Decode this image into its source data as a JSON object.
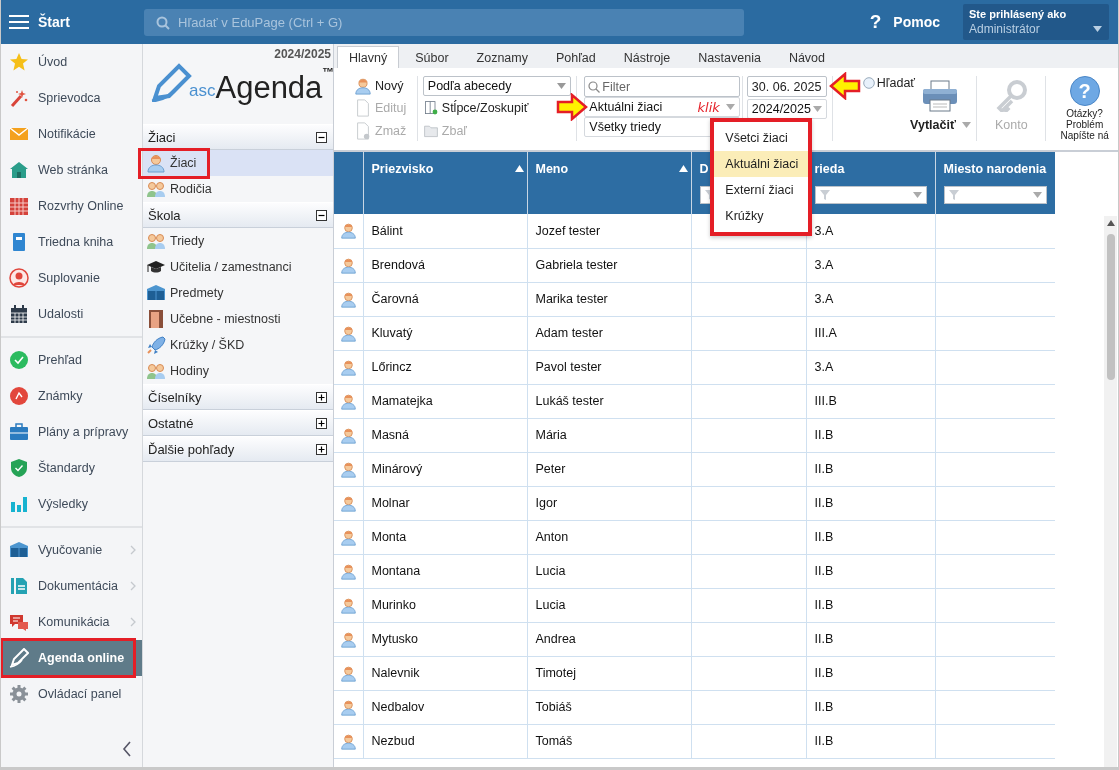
{
  "top_bar": {
    "menu_label": "Štart",
    "search": {
      "placeholder": "Hľadať v EduPage (Ctrl + G)"
    },
    "help": {
      "icon": "?",
      "label": "Pomoc"
    },
    "user": {
      "caption": "Ste prihlásený ako",
      "name": "Administrátor"
    }
  },
  "nav": {
    "sections": [
      {
        "items": [
          {
            "label": "Úvod",
            "submenu": false,
            "selected": false,
            "highlighted": false
          },
          {
            "label": "Sprievodca",
            "submenu": false,
            "selected": false,
            "highlighted": false
          },
          {
            "label": "Notifikácie",
            "submenu": false,
            "selected": false,
            "highlighted": false
          },
          {
            "label": "Web stránka",
            "submenu": false,
            "selected": false,
            "highlighted": false
          },
          {
            "label": "Rozvrhy Online",
            "submenu": false,
            "selected": false,
            "highlighted": false
          },
          {
            "label": "Triedna kniha",
            "submenu": false,
            "selected": false,
            "highlighted": false
          },
          {
            "label": "Suplovanie",
            "submenu": false,
            "selected": false,
            "highlighted": false
          },
          {
            "label": "Udalosti",
            "submenu": false,
            "selected": false,
            "highlighted": false
          }
        ]
      },
      {
        "items": [
          {
            "label": "Prehľad",
            "submenu": false,
            "selected": false,
            "highlighted": false
          },
          {
            "label": "Známky",
            "submenu": false,
            "selected": false,
            "highlighted": false
          },
          {
            "label": "Plány a prípravy",
            "submenu": false,
            "selected": false,
            "highlighted": false
          },
          {
            "label": "Štandardy",
            "submenu": false,
            "selected": false,
            "highlighted": false
          },
          {
            "label": "Výsledky",
            "submenu": false,
            "selected": false,
            "highlighted": false
          }
        ]
      },
      {
        "items": [
          {
            "label": "Vyučovanie",
            "submenu": true,
            "selected": false,
            "highlighted": false
          },
          {
            "label": "Dokumentácia",
            "submenu": true,
            "selected": false,
            "highlighted": false
          },
          {
            "label": "Komunikácia",
            "submenu": true,
            "selected": false,
            "highlighted": false
          },
          {
            "label": "Agenda online",
            "submenu": false,
            "selected": true,
            "highlighted": true
          },
          {
            "label": "Ovládací panel",
            "submenu": false,
            "selected": false,
            "highlighted": false
          }
        ]
      }
    ]
  },
  "panel": {
    "year": "2024/2025",
    "logo": {
      "prefix": "asc",
      "name": "Agenda",
      "mark": "™"
    },
    "sections": [
      {
        "title": "Žiaci",
        "expanded": true,
        "items": [
          {
            "label": "Žiaci",
            "selected": true,
            "highlighted": true
          },
          {
            "label": "Rodičia",
            "selected": false,
            "highlighted": false
          }
        ]
      },
      {
        "title": "Škola",
        "expanded": true,
        "items": [
          {
            "label": "Triedy",
            "selected": false,
            "highlighted": false
          },
          {
            "label": "Učitelia / zamestnanci",
            "selected": false,
            "highlighted": false
          },
          {
            "label": "Predmety",
            "selected": false,
            "highlighted": false
          },
          {
            "label": "Učebne - miestnosti",
            "selected": false,
            "highlighted": false
          },
          {
            "label": "Krúžky / ŠKD",
            "selected": false,
            "highlighted": false
          },
          {
            "label": "Hodiny",
            "selected": false,
            "highlighted": false
          }
        ]
      },
      {
        "title": "Číselníky",
        "expanded": false
      },
      {
        "title": "Ostatné",
        "expanded": false
      },
      {
        "title": "Ďalšie pohľady",
        "expanded": false
      }
    ]
  },
  "tabs": [
    {
      "label": "Hlavný",
      "selected": true
    },
    {
      "label": "Súbor",
      "selected": false
    },
    {
      "label": "Zoznamy",
      "selected": false
    },
    {
      "label": "Pohľad",
      "selected": false
    },
    {
      "label": "Nástroje",
      "selected": false
    },
    {
      "label": "Nastavenia",
      "selected": false
    },
    {
      "label": "Návod",
      "selected": false
    }
  ],
  "toolbar": {
    "actions": [
      {
        "label": "Nový",
        "kind": "new",
        "disabled": false
      },
      {
        "label": "Edituj",
        "kind": "edit",
        "disabled": true
      },
      {
        "label": "Zmaž",
        "kind": "delete",
        "disabled": true
      }
    ],
    "sort_select": {
      "value": "Podľa abecedy"
    },
    "columns_button": {
      "label": "Stĺpce/Zoskupiť",
      "disabled": false
    },
    "collapse_button": {
      "label": "Zbaľ",
      "disabled": true
    },
    "filter": {
      "placeholder": "Filter"
    },
    "student_select": {
      "value": "Aktuálni žiaci",
      "note": "klik",
      "pointer_arrow": true,
      "expanded": true,
      "options": [
        {
          "label": "Všetci žiaci",
          "selected": false
        },
        {
          "label": "Aktuálni žiaci",
          "selected": true
        },
        {
          "label": "Externí žiaci",
          "selected": false
        },
        {
          "label": "Krúžky",
          "selected": false
        }
      ]
    },
    "class_select": {
      "value": "Všetky triedy"
    },
    "date_field": {
      "value": "30. 06. 2025",
      "pointer_arrow": true
    },
    "year_select": {
      "value": "2024/2025"
    },
    "search_toggle": {
      "label": "Hľadať"
    },
    "print_button": {
      "label": "Vytlačiť"
    },
    "account_button": {
      "label": "Konto",
      "disabled": true
    },
    "help_button": {
      "icon": "?",
      "lines": [
        "Otázky?",
        "Problém",
        "Napíšte ná"
      ]
    }
  },
  "table": {
    "columns": [
      {
        "sorted": false,
        "filter": false
      },
      {
        "label": "Priezvisko",
        "sorted": true,
        "filter": false
      },
      {
        "label": "Meno",
        "sorted": true,
        "filter": false
      },
      {
        "label": "D",
        "sorted": false,
        "filter": true
      },
      {
        "label": "rieda",
        "sorted": false,
        "filter": true
      },
      {
        "label": "Miesto narodenia",
        "sorted": false,
        "filter": true
      }
    ],
    "rows": [
      [
        "",
        "Bálint",
        "Jozef tester",
        "",
        "3.A",
        ""
      ],
      [
        "",
        "Brendová",
        "Gabriela tester",
        "",
        "3.A",
        ""
      ],
      [
        "",
        "Čarovná",
        "Marika tester",
        "",
        "3.A",
        ""
      ],
      [
        "",
        "Kluvatý",
        "Adam tester",
        "",
        "III.A",
        ""
      ],
      [
        "",
        "Lőrincz",
        "Pavol tester",
        "",
        "3.A",
        ""
      ],
      [
        "",
        "Mamatejka",
        "Lukáš tester",
        "",
        "III.B",
        ""
      ],
      [
        "",
        "Masná",
        "Mária",
        "",
        "II.B",
        ""
      ],
      [
        "",
        "Minárový",
        "Peter",
        "",
        "II.B",
        ""
      ],
      [
        "",
        "Molnar",
        "Igor",
        "",
        "II.B",
        ""
      ],
      [
        "",
        "Monta",
        "Anton",
        "",
        "II.B",
        ""
      ],
      [
        "",
        "Montana",
        "Lucia",
        "",
        "II.B",
        ""
      ],
      [
        "",
        "Murinko",
        "Lucia",
        "",
        "II.B",
        ""
      ],
      [
        "",
        "Mytusko",
        "Andrea",
        "",
        "II.B",
        ""
      ],
      [
        "",
        "Nalevnik",
        "Timotej",
        "",
        "II.B",
        ""
      ],
      [
        "",
        "Nedbalov",
        "Tobiáš",
        "",
        "II.B",
        ""
      ],
      [
        "",
        "Nezbud",
        "Tomáš",
        "",
        "II.B",
        ""
      ]
    ]
  }
}
